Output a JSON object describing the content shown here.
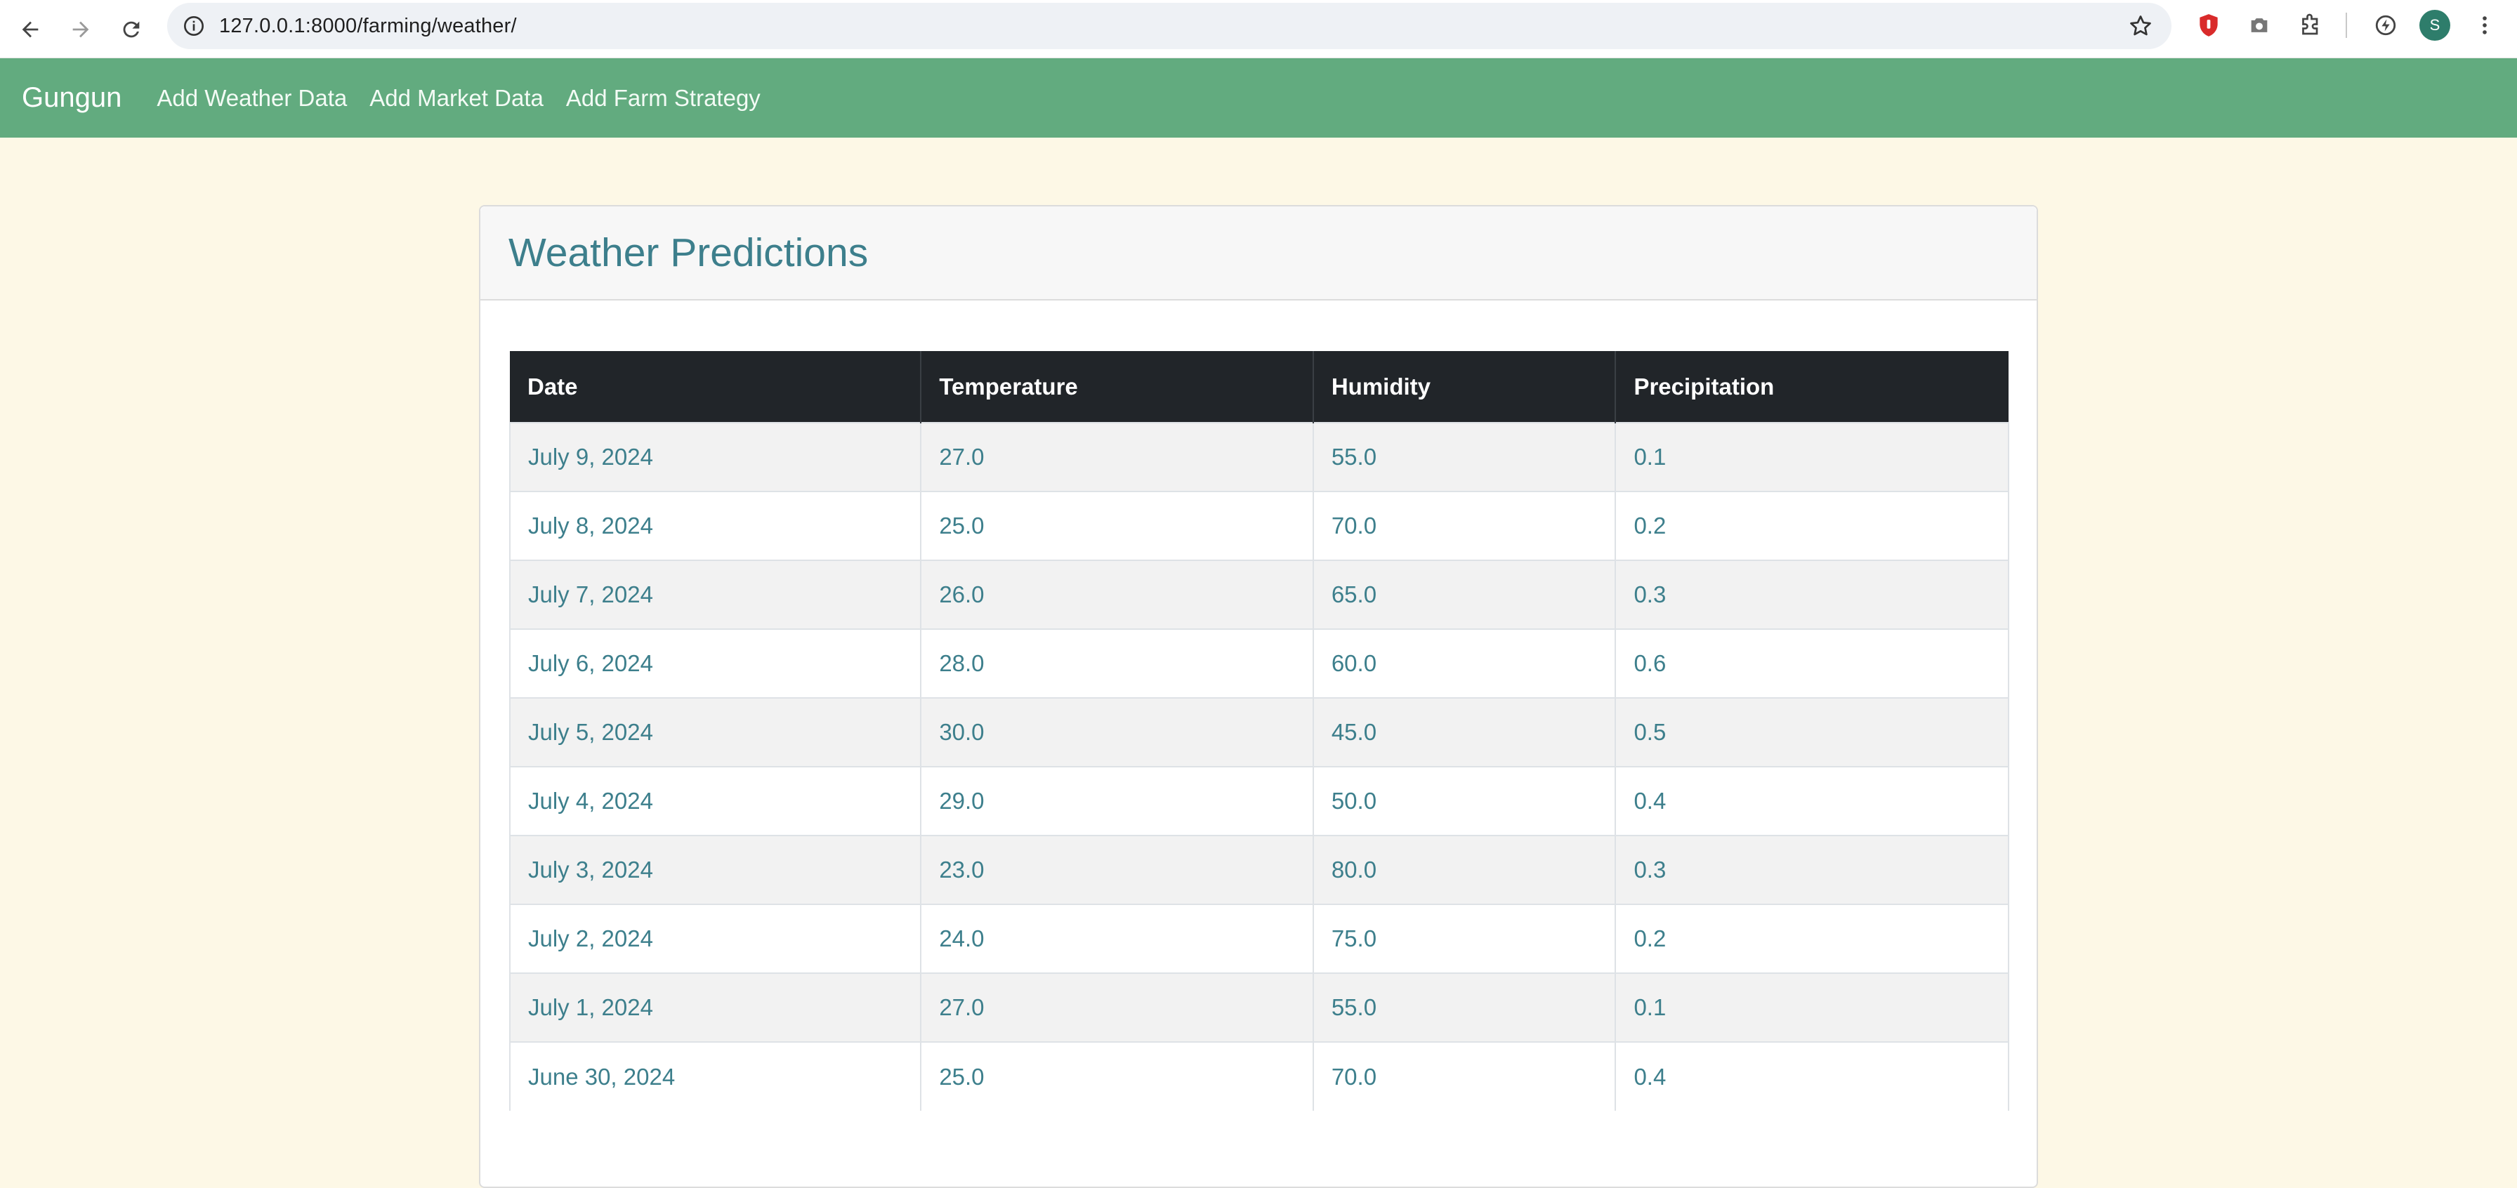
{
  "browser": {
    "url": "127.0.0.1:8000/farming/weather/",
    "profile_initial": "S"
  },
  "navbar": {
    "brand": "Gungun",
    "links": [
      "Add Weather Data",
      "Add Market Data",
      "Add Farm Strategy"
    ]
  },
  "card": {
    "title": "Weather Predictions"
  },
  "table": {
    "headers": [
      "Date",
      "Temperature",
      "Humidity",
      "Precipitation"
    ],
    "rows": [
      [
        "July 9, 2024",
        "27.0",
        "55.0",
        "0.1"
      ],
      [
        "July 8, 2024",
        "25.0",
        "70.0",
        "0.2"
      ],
      [
        "July 7, 2024",
        "26.0",
        "65.0",
        "0.3"
      ],
      [
        "July 6, 2024",
        "28.0",
        "60.0",
        "0.6"
      ],
      [
        "July 5, 2024",
        "30.0",
        "45.0",
        "0.5"
      ],
      [
        "July 4, 2024",
        "29.0",
        "50.0",
        "0.4"
      ],
      [
        "July 3, 2024",
        "23.0",
        "80.0",
        "0.3"
      ],
      [
        "July 2, 2024",
        "24.0",
        "75.0",
        "0.2"
      ],
      [
        "July 1, 2024",
        "27.0",
        "55.0",
        "0.1"
      ],
      [
        "June 30, 2024",
        "25.0",
        "70.0",
        "0.4"
      ]
    ]
  },
  "colors": {
    "navbar_bg": "#62ab7f",
    "page_bg": "#fdf8e6",
    "accent_text": "#3d7f8c",
    "table_header_bg": "#212529"
  }
}
